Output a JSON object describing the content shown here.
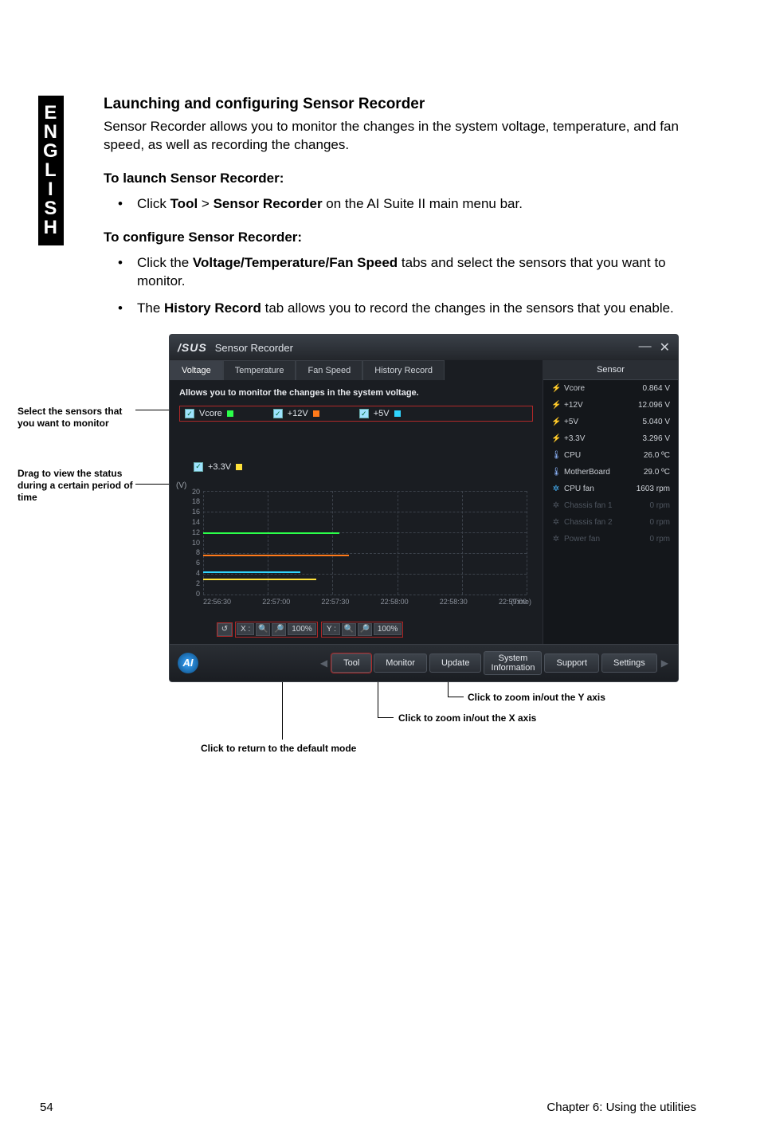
{
  "side_tab": "ENGLISH",
  "heading": "Launching and configuring Sensor Recorder",
  "intro": "Sensor Recorder allows you to monitor the changes in the system voltage, temperature, and fan speed, as well as recording the changes.",
  "launch_head": "To launch Sensor Recorder:",
  "launch_item_pre": "Click ",
  "launch_tool": "Tool",
  "launch_gt": " > ",
  "launch_sr": "Sensor Recorder",
  "launch_item_post": " on the AI Suite II main menu bar.",
  "config_head": "To configure Sensor Recorder:",
  "config_item1_pre": "Click the ",
  "config_item1_bold": "Voltage/Temperature/Fan Speed",
  "config_item1_post": " tabs and select the sensors that you want to monitor.",
  "config_item2_pre": "The ",
  "config_item2_bold": "History Record",
  "config_item2_post": " tab allows you to record the changes in the sensors that you enable.",
  "left_label1": "Select the sensors that you want to monitor",
  "left_label2": "Drag to view the status during a certain period of time",
  "app": {
    "logo": "/SUS",
    "title": "Sensor Recorder",
    "min": "—",
    "close": "✕",
    "tabs": {
      "voltage": "Voltage",
      "temperature": "Temperature",
      "fan": "Fan Speed",
      "history": "History Record"
    },
    "caption": "Allows you to monitor the changes in the system voltage.",
    "checks": {
      "vcore": "Vcore",
      "p12v": "+12V",
      "p5v": "+5V",
      "p33v": "+3.3V"
    },
    "checkmark": "✓",
    "yunit": "(V)",
    "yticks": [
      "20",
      "18",
      "16",
      "14",
      "12",
      "10",
      "8",
      "6",
      "4",
      "2",
      "0"
    ],
    "xticks": [
      "22:56:30",
      "22:57:00",
      "22:57:30",
      "22:58:00",
      "22:58:30",
      "22:59:00"
    ],
    "timelabel": "(Time)",
    "zoom": {
      "reset": "↺",
      "xlab": "X :",
      "ylab": "Y :",
      "zin": "🔍",
      "zout": "🔎",
      "pct": "100%"
    },
    "sensor_header": "Sensor",
    "sensors": [
      {
        "icon": "⚡",
        "cls": "bolt",
        "name": "Vcore",
        "val": "0.864 V"
      },
      {
        "icon": "⚡",
        "cls": "bolt",
        "name": "+12V",
        "val": "12.096 V"
      },
      {
        "icon": "⚡",
        "cls": "bolt",
        "name": "+5V",
        "val": "5.040 V"
      },
      {
        "icon": "⚡",
        "cls": "bolt",
        "name": "+3.3V",
        "val": "3.296 V"
      },
      {
        "icon": "🌡",
        "cls": "therm",
        "name": "CPU",
        "val": "26.0 ºC"
      },
      {
        "icon": "🌡",
        "cls": "therm",
        "name": "MotherBoard",
        "val": "29.0 ºC"
      },
      {
        "icon": "✲",
        "cls": "fanic",
        "name": "CPU fan",
        "val": "1603 rpm"
      }
    ],
    "sensors_dim": [
      {
        "icon": "✲",
        "name": "Chassis fan 1",
        "val": "0 rpm"
      },
      {
        "icon": "✲",
        "name": "Chassis fan 2",
        "val": "0 rpm"
      },
      {
        "icon": "✲",
        "name": "Power fan",
        "val": "0 rpm"
      }
    ],
    "ai": "AI",
    "nav_left": "◀",
    "nav_right": "▶",
    "buttons": {
      "tool": "Tool",
      "monitor": "Monitor",
      "update": "Update",
      "sysinfo": "System\nInformation",
      "support": "Support",
      "settings": "Settings"
    }
  },
  "callout_y": "Click to zoom in/out the Y axis",
  "callout_x": "Click to zoom in/out the X axis",
  "callout_r": "Click to return to the default mode",
  "footer_left": "54",
  "footer_right": "Chapter 6: Using the utilities"
}
